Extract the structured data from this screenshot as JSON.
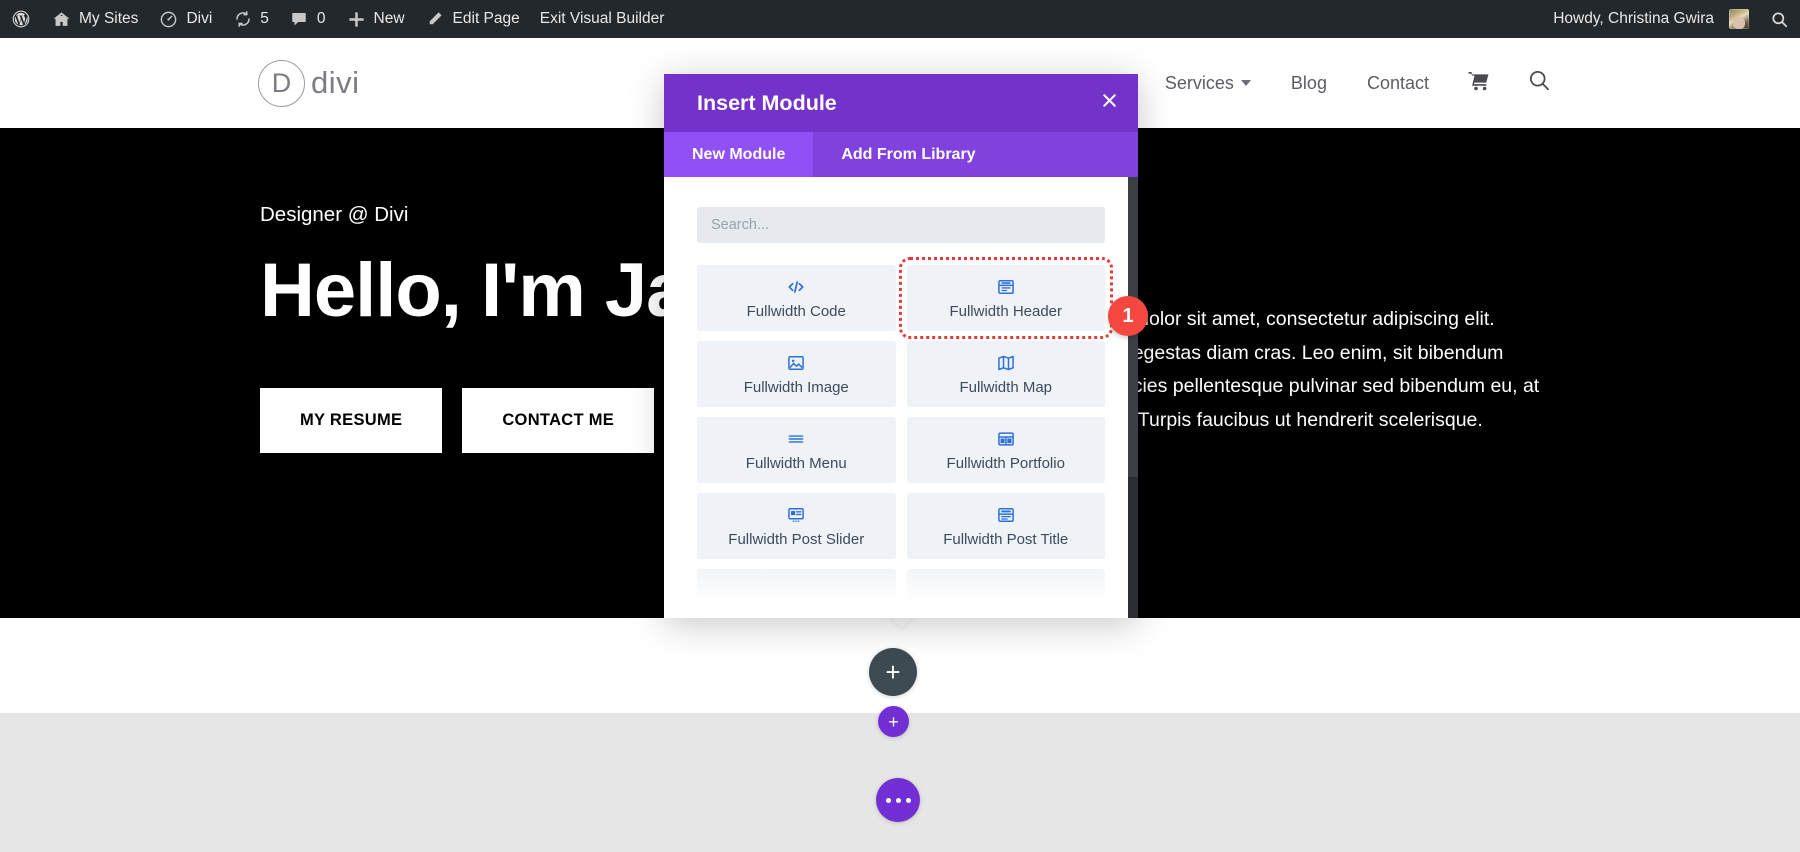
{
  "admin_bar": {
    "left_items": [
      {
        "icon": "wordpress-icon",
        "label": ""
      },
      {
        "icon": "sites-icon",
        "label": "My Sites"
      },
      {
        "icon": "divi-icon",
        "label": "Divi"
      },
      {
        "icon": "updates-icon",
        "label": "5"
      },
      {
        "icon": "comments-icon",
        "label": "0"
      },
      {
        "icon": "plus-icon",
        "label": "New"
      },
      {
        "icon": "pencil-icon",
        "label": "Edit Page"
      },
      {
        "icon": "",
        "label": "Exit Visual Builder"
      }
    ],
    "howdy": "Howdy, Christina Gwira",
    "search_icon": "search-icon"
  },
  "site_header": {
    "logo_mark": "D",
    "logo_text": "divi",
    "nav": [
      {
        "label": "",
        "has_dropdown": true
      },
      {
        "label": "Services",
        "has_dropdown": true
      },
      {
        "label": "Blog",
        "has_dropdown": false
      },
      {
        "label": "Contact",
        "has_dropdown": false
      }
    ],
    "cart_icon": "shopping-cart-icon",
    "search_icon": "search-icon"
  },
  "hero": {
    "eyebrow": "Designer @ Divi",
    "title": "Hello, I'm Jane",
    "buttons": [
      {
        "label": "MY RESUME"
      },
      {
        "label": "CONTACT ME"
      }
    ],
    "paragraph": "Lorem ipsum dolor sit amet, consectetur adipiscing elit. Ipsum purus egestas diam cras. Leo enim, sit bibendum pulvinar. Ultricies pellentesque pulvinar sed bibendum eu, at velit pulvinar. Turpis faucibus ut hendrerit scelerisque."
  },
  "modal": {
    "title": "Insert Module",
    "close_icon": "close-icon",
    "tabs": [
      {
        "label": "New Module",
        "active": true
      },
      {
        "label": "Add From Library",
        "active": false
      }
    ],
    "search": {
      "value": "",
      "placeholder": "Search..."
    },
    "modules": [
      {
        "label": "Fullwidth Code",
        "icon": "code-icon",
        "highlighted": false
      },
      {
        "label": "Fullwidth Header",
        "icon": "header-icon",
        "highlighted": true
      },
      {
        "label": "Fullwidth Image",
        "icon": "image-icon",
        "highlighted": false
      },
      {
        "label": "Fullwidth Map",
        "icon": "map-icon",
        "highlighted": false
      },
      {
        "label": "Fullwidth Menu",
        "icon": "menu-icon",
        "highlighted": false
      },
      {
        "label": "Fullwidth Portfolio",
        "icon": "portfolio-grid-icon",
        "highlighted": false
      },
      {
        "label": "Fullwidth Post Slider",
        "icon": "post-slider-icon",
        "highlighted": false
      },
      {
        "label": "Fullwidth Post Title",
        "icon": "post-title-icon",
        "highlighted": false
      }
    ],
    "step_badge": "1"
  },
  "builder_controls": {
    "add_section_label": "+",
    "add_row_label": "+",
    "more_label": "more-options-icon"
  },
  "colors": {
    "modal_header_purple": "#7332c9",
    "tab_active_purple": "#9150f5",
    "tab_inactive_purple": "#8141df",
    "badge_red": "#f4473f",
    "module_icon_blue": "#2c71d8",
    "admin_bar_dark": "#23282d",
    "builder_purple": "#7230d4",
    "add_section_gray": "#3e4a52",
    "highlight_outline_red": "#e33b3b"
  }
}
